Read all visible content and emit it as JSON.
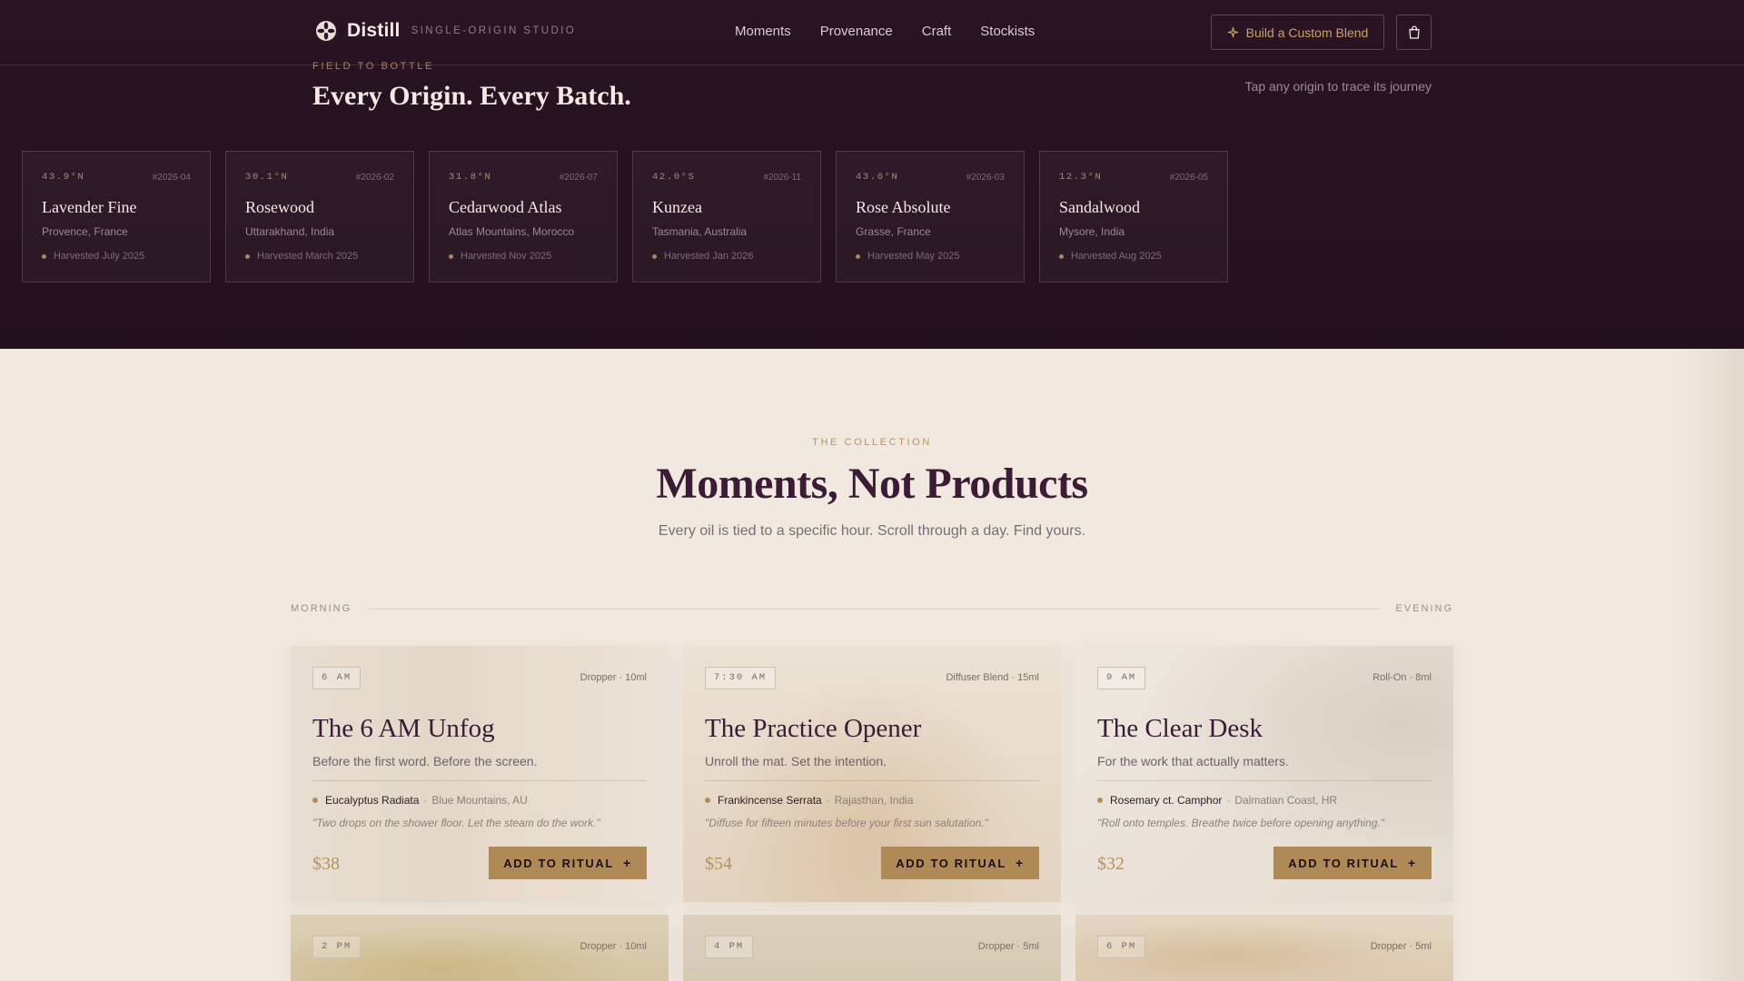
{
  "header": {
    "brand_name": "Distill",
    "brand_tagline": "SINGLE-ORIGIN STUDIO",
    "nav": [
      "Moments",
      "Provenance",
      "Craft",
      "Stockists"
    ],
    "cta_label": "Build a Custom Blend",
    "cart_icon": "shopping-bag-icon"
  },
  "origins": {
    "eyebrow": "FIELD TO BOTTLE",
    "title": "Every Origin. Every Batch.",
    "hint": "Tap any origin to trace its journey",
    "cards": [
      {
        "coord": "43.9°N",
        "batch": "#2026-04",
        "name": "Lavender Fine",
        "location": "Provence, France",
        "harvest": "Harvested July 2025"
      },
      {
        "coord": "30.1°N",
        "batch": "#2026-02",
        "name": "Rosewood",
        "location": "Uttarakhand, India",
        "harvest": "Harvested March 2025"
      },
      {
        "coord": "31.8°N",
        "batch": "#2026-07",
        "name": "Cedarwood Atlas",
        "location": "Atlas Mountains, Morocco",
        "harvest": "Harvested Nov 2025"
      },
      {
        "coord": "42.0°S",
        "batch": "#2026-11",
        "name": "Kunzea",
        "location": "Tasmania, Australia",
        "harvest": "Harvested Jan 2026"
      },
      {
        "coord": "43.6°N",
        "batch": "#2026-03",
        "name": "Rose Absolute",
        "location": "Grasse, France",
        "harvest": "Harvested May 2025"
      },
      {
        "coord": "12.3°N",
        "batch": "#2026-05",
        "name": "Sandalwood",
        "location": "Mysore, India",
        "harvest": "Harvested Aug 2025"
      }
    ]
  },
  "collection": {
    "eyebrow": "THE COLLECTION",
    "title": "Moments, Not Products",
    "subtitle": "Every oil is tied to a specific hour. Scroll through a day. Find yours.",
    "timeline_start": "MORNING",
    "timeline_end": "EVENING",
    "add_label": "ADD TO RITUAL",
    "add_icon": "+",
    "products": [
      {
        "time": "6 AM",
        "format": "Dropper · 10ml",
        "title": "The 6 AM Unfog",
        "tagline": "Before the first word. Before the screen.",
        "ingredient": "Eucalyptus Radiata",
        "origin": "Blue Mountains, AU",
        "quote": "\"Two drops on the shower floor. Let the steam do the work.\"",
        "price": "$38"
      },
      {
        "time": "7:30 AM",
        "format": "Diffuser Blend · 15ml",
        "title": "The Practice Opener",
        "tagline": "Unroll the mat. Set the intention.",
        "ingredient": "Frankincense Serrata",
        "origin": "Rajasthan, India",
        "quote": "\"Diffuse for fifteen minutes before your first sun salutation.\"",
        "price": "$54"
      },
      {
        "time": "9 AM",
        "format": "Roll-On · 8ml",
        "title": "The Clear Desk",
        "tagline": "For the work that actually matters.",
        "ingredient": "Rosemary ct. Camphor",
        "origin": "Dalmatian Coast, HR",
        "quote": "\"Roll onto temples. Breathe twice before opening anything.\"",
        "price": "$32"
      },
      {
        "time": "2 PM",
        "format": "Dropper · 10ml"
      },
      {
        "time": "4 PM",
        "format": "Dropper · 5ml"
      },
      {
        "time": "6 PM",
        "format": "Dropper · 5ml"
      }
    ]
  },
  "colors": {
    "dark_bg": "#261120",
    "light_bg": "#f1e9df",
    "accent_gold": "#b08a54",
    "plum": "#3b1b36"
  }
}
